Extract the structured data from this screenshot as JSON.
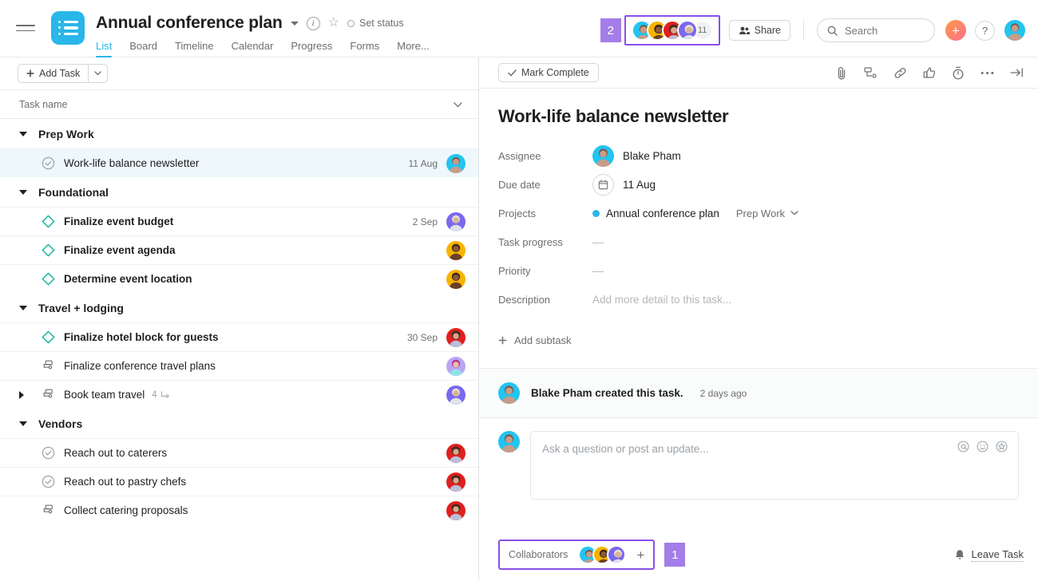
{
  "header": {
    "project_title": "Annual conference plan",
    "set_status_label": "Set status",
    "info_icon_label": "i",
    "tabs": [
      {
        "label": "List",
        "active": true
      },
      {
        "label": "Board",
        "active": false
      },
      {
        "label": "Timeline",
        "active": false
      },
      {
        "label": "Calendar",
        "active": false
      },
      {
        "label": "Progress",
        "active": false
      },
      {
        "label": "Forms",
        "active": false
      },
      {
        "label": "More...",
        "active": false
      }
    ],
    "annotation_badge_2": "2",
    "members_overflow_count": "11",
    "share_label": "Share",
    "search_placeholder": "Search",
    "plus_label": "+",
    "help_label": "?",
    "accent_color": "#29b6e8",
    "annotation_color": "#8a4fe8",
    "badge_color": "#a37ee8"
  },
  "left_panel": {
    "add_task_label": "Add Task",
    "column_header": "Task name",
    "sections": [
      {
        "name": "Prep Work",
        "expanded": true,
        "tasks": [
          {
            "name": "Work-life balance newsletter",
            "icon": "check-circle-icon",
            "date": "11 Aug",
            "avatar": "cyan",
            "bold": false,
            "selected": true,
            "caret": "none",
            "subtasks": ""
          }
        ]
      },
      {
        "name": "Foundational",
        "expanded": true,
        "tasks": [
          {
            "name": "Finalize event budget",
            "icon": "milestone-diamond-icon",
            "date": "2 Sep",
            "avatar": "purple",
            "bold": true,
            "selected": false,
            "caret": "none",
            "subtasks": ""
          },
          {
            "name": "Finalize event agenda",
            "icon": "milestone-diamond-icon",
            "date": "",
            "avatar": "yellow",
            "bold": true,
            "selected": false,
            "caret": "none",
            "subtasks": ""
          },
          {
            "name": "Determine event location",
            "icon": "milestone-diamond-icon",
            "date": "",
            "avatar": "yellow",
            "bold": true,
            "selected": false,
            "caret": "none",
            "subtasks": ""
          }
        ]
      },
      {
        "name": "Travel + lodging",
        "expanded": true,
        "tasks": [
          {
            "name": "Finalize hotel block for guests",
            "icon": "milestone-diamond-icon",
            "date": "30 Sep",
            "avatar": "red",
            "bold": true,
            "selected": false,
            "caret": "none",
            "subtasks": ""
          },
          {
            "name": "Finalize conference travel plans",
            "icon": "subtask-icon",
            "date": "",
            "avatar": "lightpurple",
            "bold": false,
            "selected": false,
            "caret": "none",
            "subtasks": ""
          },
          {
            "name": "Book team travel",
            "icon": "subtask-icon",
            "date": "",
            "avatar": "purple",
            "bold": false,
            "selected": false,
            "caret": "right",
            "subtasks": "4"
          }
        ]
      },
      {
        "name": "Vendors",
        "expanded": true,
        "tasks": [
          {
            "name": "Reach out to caterers",
            "icon": "check-circle-icon",
            "date": "",
            "avatar": "red",
            "bold": false,
            "selected": false,
            "caret": "none",
            "subtasks": ""
          },
          {
            "name": "Reach out to pastry chefs",
            "icon": "check-circle-icon",
            "date": "",
            "avatar": "red",
            "bold": false,
            "selected": false,
            "caret": "none",
            "subtasks": ""
          },
          {
            "name": "Collect catering proposals",
            "icon": "subtask-icon",
            "date": "",
            "avatar": "red",
            "bold": false,
            "selected": false,
            "caret": "none",
            "subtasks": ""
          }
        ]
      }
    ],
    "milestone_color": "#14b5a0"
  },
  "detail_panel": {
    "mark_complete_label": "Mark Complete",
    "task_title": "Work-life balance newsletter",
    "fields": {
      "assignee_label": "Assignee",
      "assignee_name": "Blake Pham",
      "due_date_label": "Due date",
      "due_date_value": "11 Aug",
      "projects_label": "Projects",
      "project_name": "Annual conference plan",
      "project_section": "Prep Work",
      "task_progress_label": "Task progress",
      "task_progress_value": "—",
      "priority_label": "Priority",
      "priority_value": "—",
      "description_label": "Description",
      "description_placeholder": "Add more detail to this task..."
    },
    "add_subtask_label": "Add subtask",
    "activity": {
      "text": "Blake Pham created this task.",
      "time": "2 days ago"
    },
    "comment_placeholder": "Ask a question or post an update...",
    "collaborators_label": "Collaborators",
    "collaborators_add": "+",
    "annotation_badge_1": "1",
    "leave_task_label": "Leave Task"
  }
}
